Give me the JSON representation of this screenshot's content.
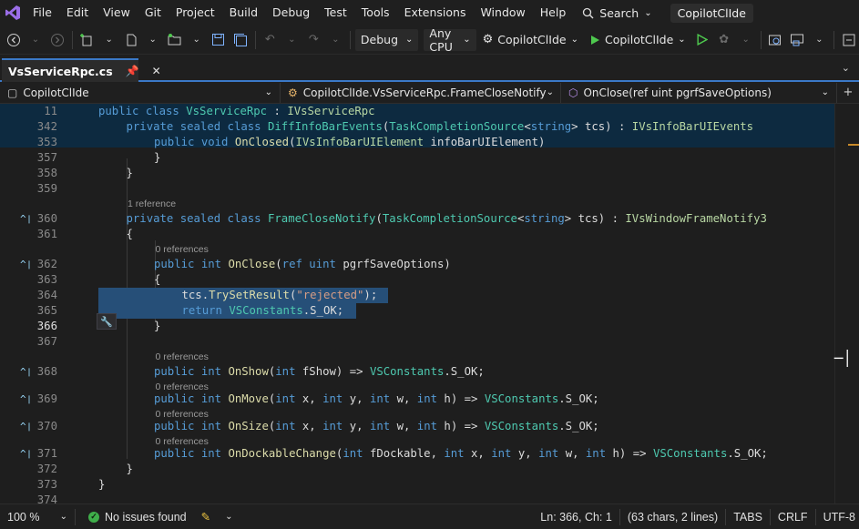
{
  "menu": {
    "items": [
      "File",
      "Edit",
      "View",
      "Git",
      "Project",
      "Build",
      "Debug",
      "Test",
      "Tools",
      "Extensions",
      "Window",
      "Help"
    ],
    "search_label": "Search",
    "solution_name": "CopilotClIde"
  },
  "toolbar": {
    "configuration": "Debug",
    "platform": "Any CPU",
    "startup_project": "CopilotClIde",
    "run_label": "CopilotClIde"
  },
  "tab": {
    "title": "VsServiceRpc.cs"
  },
  "navbar": {
    "project": "CopilotClIde",
    "type": "CopilotClIde.VsServiceRpc.FrameCloseNotify",
    "member": "OnClose(ref uint pgrfSaveOptions)"
  },
  "sticky_lines": [
    {
      "num": "11",
      "indent": 0,
      "tokens": [
        [
          "kw",
          "public class "
        ],
        [
          "ty",
          "VsServiceRpc"
        ],
        [
          "pn",
          " : "
        ],
        [
          "it",
          "IVsServiceRpc"
        ]
      ]
    },
    {
      "num": "342",
      "indent": 1,
      "tokens": [
        [
          "kw",
          "private sealed class "
        ],
        [
          "ty",
          "DiffInfoBarEvents"
        ],
        [
          "pn",
          "("
        ],
        [
          "ty",
          "TaskCompletionSource"
        ],
        [
          "pn",
          "<"
        ],
        [
          "kw",
          "string"
        ],
        [
          "pn",
          "> "
        ],
        [
          "pn",
          "tcs) : "
        ],
        [
          "it",
          "IVsInfoBarUIEvents"
        ]
      ]
    },
    {
      "num": "353",
      "indent": 2,
      "tokens": [
        [
          "kw",
          "public void "
        ],
        [
          "fn",
          "OnClosed"
        ],
        [
          "pn",
          "("
        ],
        [
          "it",
          "IVsInfoBarUIElement"
        ],
        [
          "pn",
          " infoBarUIElement)"
        ]
      ]
    }
  ],
  "code_lines": [
    {
      "num": "357",
      "indent": 2,
      "tokens": [
        [
          "pn",
          "}"
        ]
      ]
    },
    {
      "num": "358",
      "indent": 1,
      "tokens": [
        [
          "pn",
          "}"
        ]
      ]
    },
    {
      "num": "359",
      "indent": 0,
      "tokens": []
    },
    {
      "num": "360",
      "indent": 1,
      "fold": true,
      "lens": "1 reference",
      "tokens": [
        [
          "kw",
          "private sealed class "
        ],
        [
          "ty",
          "FrameCloseNotify"
        ],
        [
          "pn",
          "("
        ],
        [
          "ty",
          "TaskCompletionSource"
        ],
        [
          "pn",
          "<"
        ],
        [
          "kw",
          "string"
        ],
        [
          "pn",
          "> tcs) : "
        ],
        [
          "it",
          "IVsWindowFrameNotify3"
        ]
      ]
    },
    {
      "num": "361",
      "indent": 1,
      "tokens": [
        [
          "pn",
          "{"
        ]
      ]
    },
    {
      "num": "362",
      "indent": 2,
      "fold": true,
      "lens": "0 references",
      "tokens": [
        [
          "kw",
          "public int "
        ],
        [
          "fn",
          "OnClose"
        ],
        [
          "pn",
          "("
        ],
        [
          "kw",
          "ref uint "
        ],
        [
          "pn",
          "pgrfSaveOptions)"
        ]
      ]
    },
    {
      "num": "363",
      "indent": 2,
      "tokens": [
        [
          "pn",
          "{"
        ]
      ]
    },
    {
      "num": "364",
      "indent": 3,
      "selected": true,
      "tokens": [
        [
          "pn",
          "tcs."
        ],
        [
          "fn",
          "TrySetResult"
        ],
        [
          "pn",
          "("
        ],
        [
          "st",
          "\"rejected\""
        ],
        [
          "pn",
          ");"
        ]
      ]
    },
    {
      "num": "365",
      "indent": 3,
      "selected": true,
      "tokens": [
        [
          "kw",
          "return "
        ],
        [
          "ty",
          "VSConstants"
        ],
        [
          "pn",
          ".S_OK;"
        ]
      ]
    },
    {
      "num": "366",
      "indent": 2,
      "current": true,
      "tokens": [
        [
          "pn",
          "}"
        ]
      ]
    },
    {
      "num": "367",
      "indent": 0,
      "tokens": []
    },
    {
      "num": "368",
      "indent": 2,
      "fold": true,
      "lens": "0 references",
      "tokens": [
        [
          "kw",
          "public int "
        ],
        [
          "fn",
          "OnShow"
        ],
        [
          "pn",
          "("
        ],
        [
          "kw",
          "int "
        ],
        [
          "pn",
          "fShow) => "
        ],
        [
          "ty",
          "VSConstants"
        ],
        [
          "pn",
          ".S_OK;"
        ]
      ]
    },
    {
      "num": "369",
      "indent": 2,
      "fold": true,
      "lens": "0 references",
      "tokens": [
        [
          "kw",
          "public int "
        ],
        [
          "fn",
          "OnMove"
        ],
        [
          "pn",
          "("
        ],
        [
          "kw",
          "int "
        ],
        [
          "pn",
          "x, "
        ],
        [
          "kw",
          "int "
        ],
        [
          "pn",
          "y, "
        ],
        [
          "kw",
          "int "
        ],
        [
          "pn",
          "w, "
        ],
        [
          "kw",
          "int "
        ],
        [
          "pn",
          "h) => "
        ],
        [
          "ty",
          "VSConstants"
        ],
        [
          "pn",
          ".S_OK;"
        ]
      ]
    },
    {
      "num": "370",
      "indent": 2,
      "fold": true,
      "lens": "0 references",
      "tokens": [
        [
          "kw",
          "public int "
        ],
        [
          "fn",
          "OnSize"
        ],
        [
          "pn",
          "("
        ],
        [
          "kw",
          "int "
        ],
        [
          "pn",
          "x, "
        ],
        [
          "kw",
          "int "
        ],
        [
          "pn",
          "y, "
        ],
        [
          "kw",
          "int "
        ],
        [
          "pn",
          "w, "
        ],
        [
          "kw",
          "int "
        ],
        [
          "pn",
          "h) => "
        ],
        [
          "ty",
          "VSConstants"
        ],
        [
          "pn",
          ".S_OK;"
        ]
      ]
    },
    {
      "num": "371",
      "indent": 2,
      "fold": true,
      "lens": "0 references",
      "tokens": [
        [
          "kw",
          "public int "
        ],
        [
          "fn",
          "OnDockableChange"
        ],
        [
          "pn",
          "("
        ],
        [
          "kw",
          "int "
        ],
        [
          "pn",
          "fDockable, "
        ],
        [
          "kw",
          "int "
        ],
        [
          "pn",
          "x, "
        ],
        [
          "kw",
          "int "
        ],
        [
          "pn",
          "y, "
        ],
        [
          "kw",
          "int "
        ],
        [
          "pn",
          "w, "
        ],
        [
          "kw",
          "int "
        ],
        [
          "pn",
          "h) => "
        ],
        [
          "ty",
          "VSConstants"
        ],
        [
          "pn",
          ".S_OK;"
        ]
      ]
    },
    {
      "num": "372",
      "indent": 1,
      "tokens": [
        [
          "pn",
          "}"
        ]
      ]
    },
    {
      "num": "373",
      "indent": 0,
      "tokens": [
        [
          "pn",
          "}"
        ]
      ]
    },
    {
      "num": "374",
      "indent": 0,
      "tokens": []
    }
  ],
  "status": {
    "zoom": "100 %",
    "issues": "No issues found",
    "position": "Ln: 366, Ch: 1",
    "selection": "(63 chars, 2 lines)",
    "indent": "TABS",
    "line_ending": "CRLF",
    "encoding": "UTF-8"
  },
  "colors": {
    "accent": "#3b79c7",
    "selection": "#264f78",
    "ok": "#3fae4a"
  }
}
